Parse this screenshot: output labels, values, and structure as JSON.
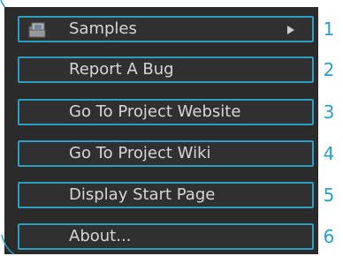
{
  "menu": {
    "items": [
      {
        "label": "Samples",
        "icon": "samples-folder-icon",
        "has_submenu": true,
        "callout": "1"
      },
      {
        "label": "Report A Bug",
        "callout": "2"
      },
      {
        "label": "Go To Project Website",
        "callout": "3"
      },
      {
        "label": "Go To Project Wiki",
        "callout": "4"
      },
      {
        "label": "Display Start Page",
        "callout": "5"
      },
      {
        "label": "About...",
        "callout": "6"
      }
    ]
  },
  "colors": {
    "panel_background": "#2b2b2b",
    "item_background": "#303030",
    "highlight_border": "#2a9fc0",
    "text": "#d6d6d6",
    "callout_text": "#2a9fc0"
  }
}
